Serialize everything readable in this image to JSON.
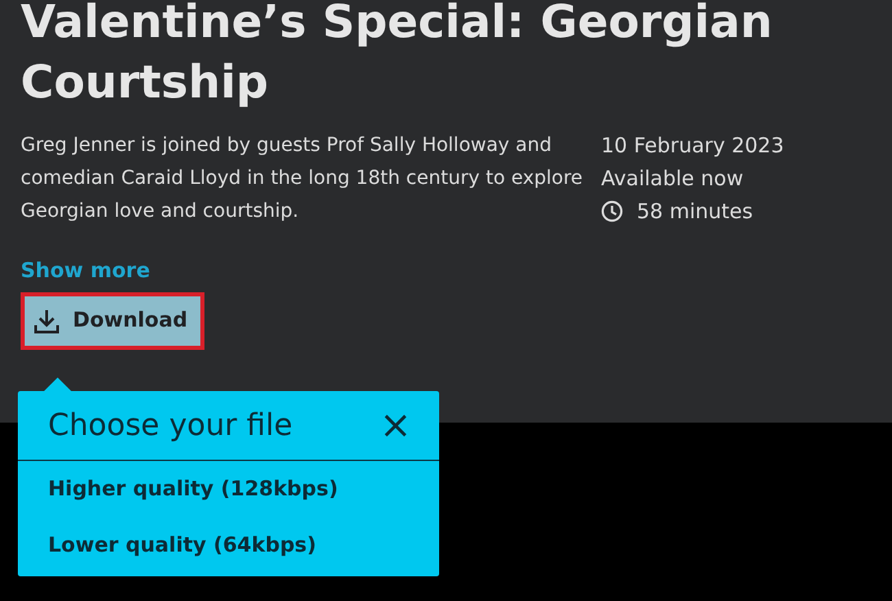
{
  "episode": {
    "title": "Valentine’s Special: Georgian Courtship",
    "description": "Greg Jenner is joined by guests Prof Sally Holloway and comedian Caraid Lloyd in the long 18th century to explore Georgian love and courtship.",
    "date": "10 February 2023",
    "availability": "Available now",
    "duration": "58 minutes",
    "show_more": "Show more"
  },
  "download_button": {
    "label": "Download",
    "focused": true
  },
  "download_menu": {
    "title": "Choose your file",
    "close": "×",
    "options": [
      {
        "label": "Higher quality (128kbps)"
      },
      {
        "label": "Lower quality (64kbps)"
      }
    ]
  }
}
